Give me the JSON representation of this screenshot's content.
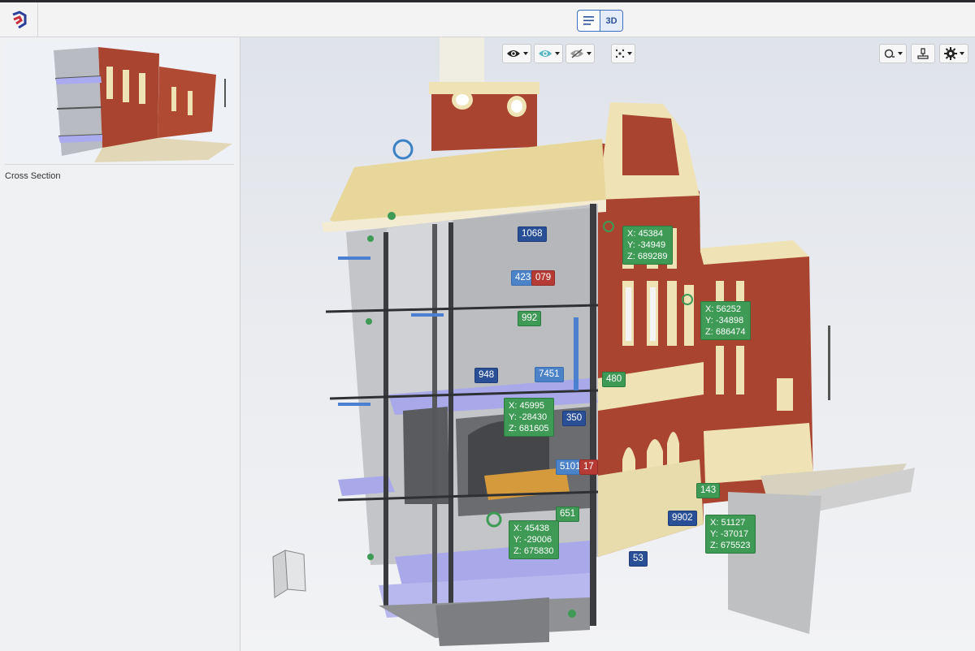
{
  "header": {
    "view_toggle": {
      "list_label": "list-icon",
      "mode_3d_label": "3D"
    }
  },
  "sidebar": {
    "section_label": "Cross Section"
  },
  "toolbar_center": {
    "visibility_icon": "eye-icon",
    "isolate_icon": "eye-tinted-icon",
    "hide_icon": "eye-slash-icon",
    "explode_icon": "explode-icon"
  },
  "toolbar_right": {
    "measure_icon": "measure-icon",
    "section_icon": "section-plane-icon",
    "settings_icon": "gear-icon"
  },
  "dimensions": [
    {
      "value": "1068",
      "style": "blue"
    },
    {
      "value": "4238",
      "style": "lblue"
    },
    {
      "value": "079",
      "style": "red"
    },
    {
      "value": "992",
      "style": "green"
    },
    {
      "value": "948",
      "style": "blue"
    },
    {
      "value": "7451",
      "style": "lblue"
    },
    {
      "value": "480",
      "style": "green"
    },
    {
      "value": "350",
      "style": "blue"
    },
    {
      "value": "5101",
      "style": "lblue"
    },
    {
      "value": "17",
      "style": "red"
    },
    {
      "value": "651",
      "style": "green"
    },
    {
      "value": "143",
      "style": "green"
    },
    {
      "value": "9902",
      "style": "blue"
    },
    {
      "value": "53",
      "style": "blue"
    }
  ],
  "coordinates": [
    {
      "x": "X: 45384",
      "y": "Y: -34949",
      "z": "Z: 689289"
    },
    {
      "x": "X: 56252",
      "y": "Y: -34898",
      "z": "Z: 686474"
    },
    {
      "x": "X: 45995",
      "y": "Y: -28430",
      "z": "Z: 681605"
    },
    {
      "x": "X: 45438",
      "y": "Y: -29006",
      "z": "Z: 675830"
    },
    {
      "x": "X: 51127",
      "y": "Y: -37017",
      "z": "Z: 675523"
    }
  ],
  "colors": {
    "brick": "#a8442f",
    "cream": "#efe2b4",
    "concrete": "#9fa2a6",
    "floor": "#a9a9ea",
    "accent": "#2c4f9e"
  }
}
